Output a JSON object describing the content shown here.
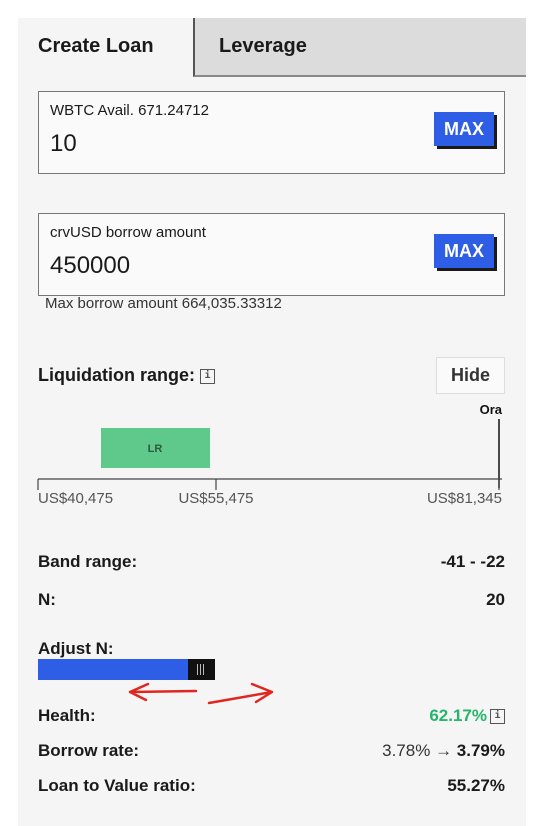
{
  "tabs": [
    {
      "label": "Create Loan",
      "active": true
    },
    {
      "label": "Leverage",
      "active": false
    }
  ],
  "collateral": {
    "label": "WBTC Avail. 671.24712",
    "value": "10",
    "max_label": "MAX"
  },
  "borrow": {
    "label": "crvUSD borrow amount",
    "value": "450000",
    "max_label": "MAX",
    "helper": "Max borrow amount 664,035.33312"
  },
  "liquidation": {
    "title": "Liquidation range:",
    "info_icon": "i",
    "hide_label": "Hide",
    "oracle_label": "Ora",
    "range_label": "LR"
  },
  "chart_data": {
    "type": "range",
    "ticks": [
      "US$40,475",
      "US$55,475",
      "US$81,345"
    ],
    "tick_values": [
      40475,
      55475,
      81345
    ],
    "range_start": 43100,
    "range_end": 55475,
    "oracle": 81345,
    "colors": {
      "range": "#5ec98b",
      "axis": "#333333"
    }
  },
  "stats": {
    "band_range": {
      "label": "Band range:",
      "value": "-41 - -22"
    },
    "n": {
      "label": "N:",
      "value": "20"
    },
    "adjust_n": {
      "label": "Adjust N:",
      "fill": 1.0
    },
    "health": {
      "label": "Health:",
      "value": "62.17%",
      "info_icon": "i"
    },
    "borrow_rate": {
      "label": "Borrow rate:",
      "from": "3.78%",
      "arrow": "→",
      "to": "3.79%"
    },
    "ltv": {
      "label": "Loan to Value ratio:",
      "value": "55.27%"
    }
  },
  "colors": {
    "accent": "#2e5de6",
    "health": "#27b46b",
    "annotation": "#e0271f"
  }
}
